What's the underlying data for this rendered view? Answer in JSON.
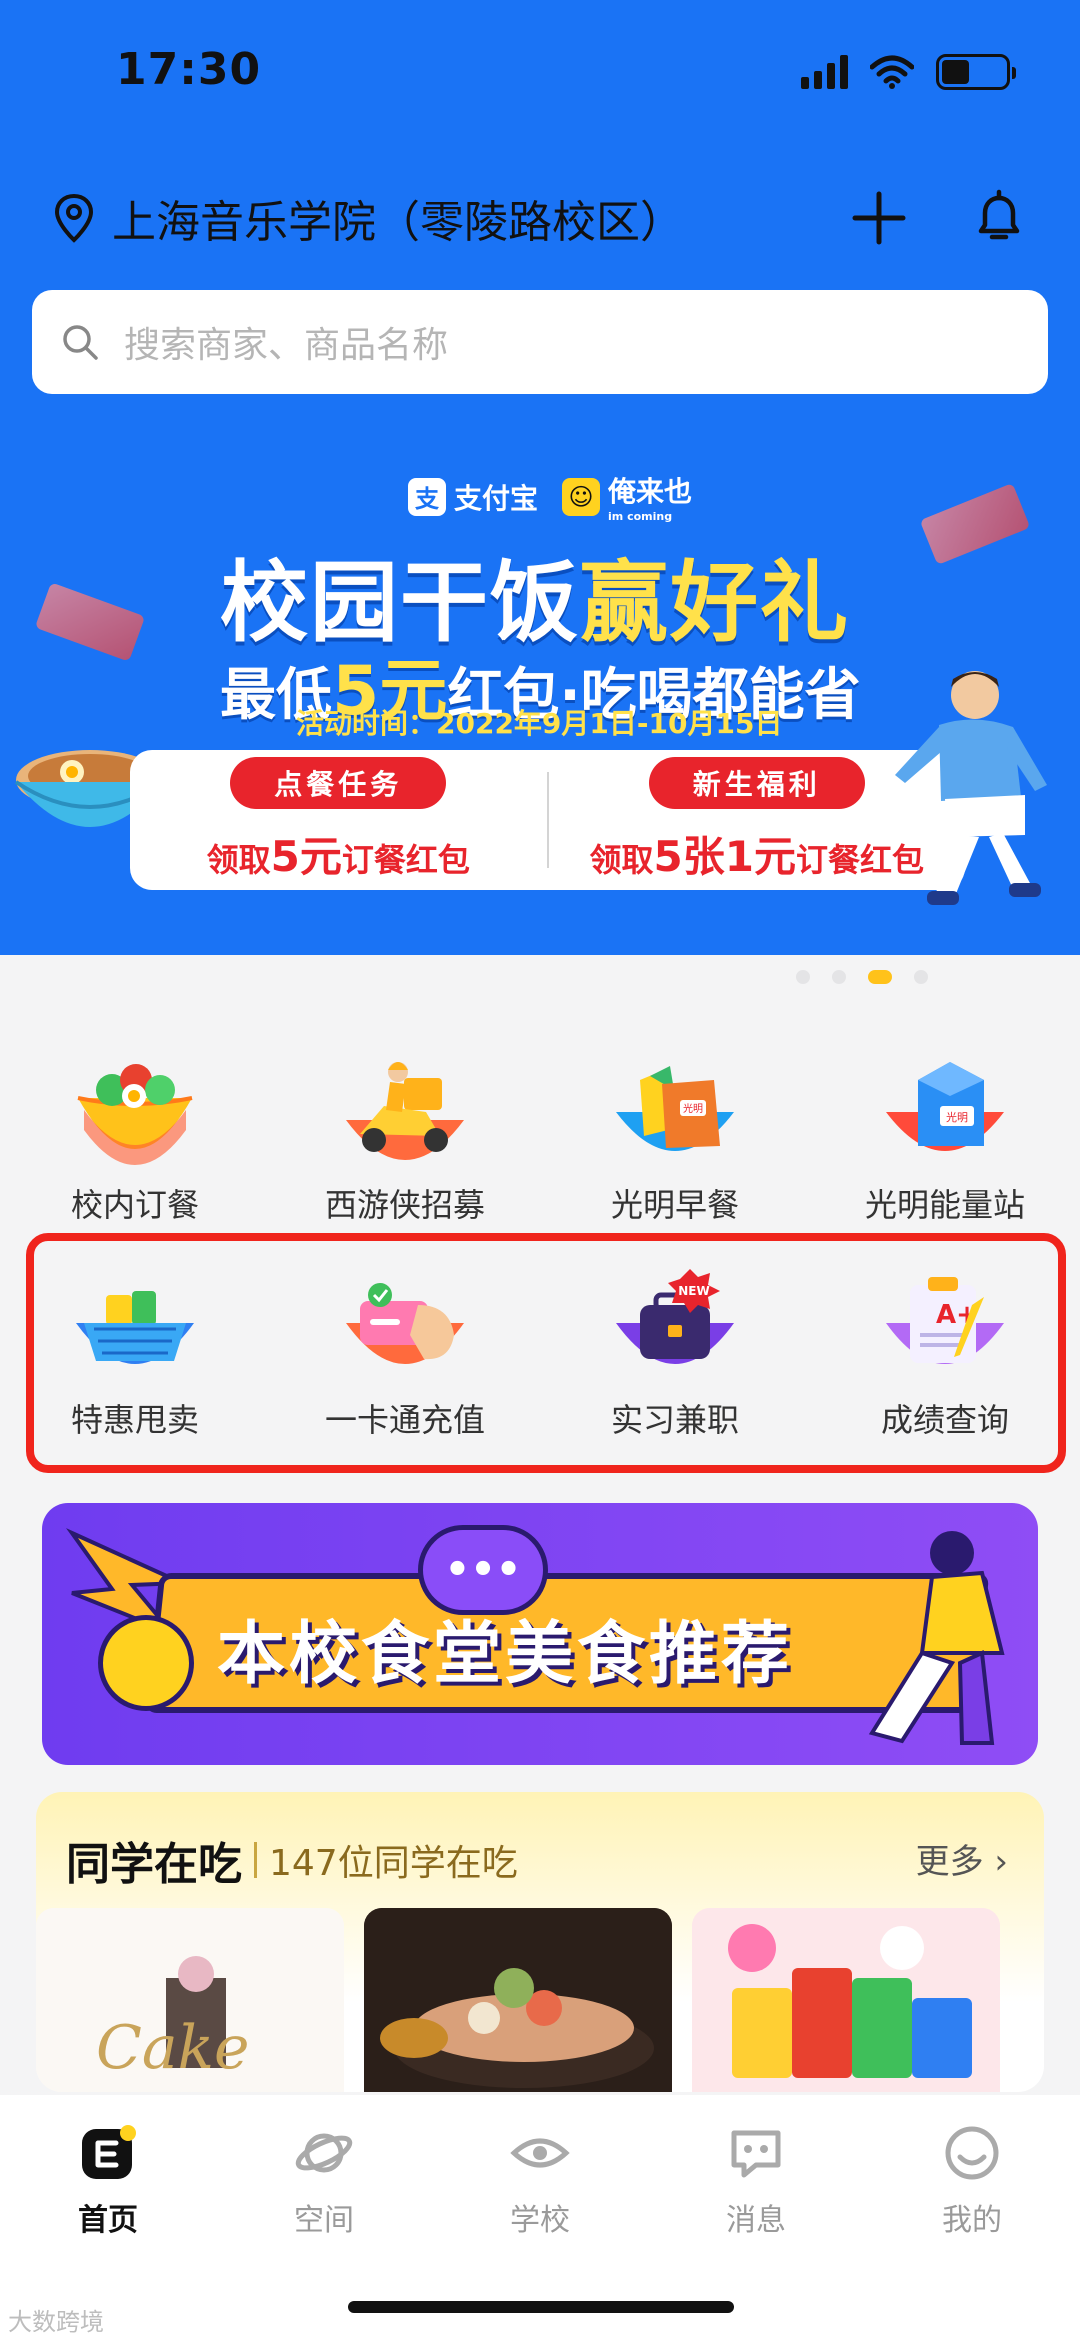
{
  "status_bar": {
    "time": "17:30"
  },
  "header": {
    "location": "上海音乐学院（零陵路校区）",
    "search_placeholder": "搜索商家、商品名称"
  },
  "banner": {
    "brand1": "支付宝",
    "brand2": "俺来也",
    "brand2_sub": "im coming",
    "title_a": "校园干饭",
    "title_b": "赢好礼",
    "sub_a": "最低",
    "sub_b": "5元",
    "sub_c": "红包·吃喝都能省",
    "date": "活动时间：2022年9月1日-10月15日",
    "left_pill": "点餐任务",
    "left_desc_a": "领取",
    "left_desc_b": "5元",
    "left_desc_c": "订餐红包",
    "right_pill": "新生福利",
    "right_desc_a": "领取",
    "right_desc_b": "5张",
    "right_desc_c": "1元",
    "right_desc_d": "订餐红包",
    "page_index": 3,
    "page_count": 4
  },
  "shortcuts_row1": [
    {
      "label": "校内订餐",
      "icon": "salad-bowl-icon"
    },
    {
      "label": "西游侠招募",
      "icon": "delivery-scooter-icon"
    },
    {
      "label": "光明早餐",
      "icon": "breakfast-bag-icon"
    },
    {
      "label": "光明能量站",
      "icon": "milk-carton-icon"
    }
  ],
  "shortcuts_row2": [
    {
      "label": "特惠甩卖",
      "icon": "shopping-basket-icon"
    },
    {
      "label": "一卡通充值",
      "icon": "card-recharge-icon"
    },
    {
      "label": "实习兼职",
      "icon": "briefcase-icon",
      "badge": "NEW"
    },
    {
      "label": "成绩查询",
      "icon": "report-card-icon",
      "grade": "A+"
    }
  ],
  "canteen_banner": {
    "text": "本校食堂美食推荐",
    "bubble": "•••"
  },
  "classmates": {
    "title": "同学在吃",
    "count": "147位同学在吃",
    "more": "更多 ›",
    "cards": [
      {
        "icon": "cake-photo",
        "caption": "Cake"
      },
      {
        "icon": "hotpot-photo"
      },
      {
        "icon": "snacks-photo"
      }
    ]
  },
  "tabbar": [
    {
      "label": "首页",
      "icon": "home-icon",
      "active": true
    },
    {
      "label": "空间",
      "icon": "planet-icon",
      "active": false
    },
    {
      "label": "学校",
      "icon": "eye-icon",
      "active": false
    },
    {
      "label": "消息",
      "icon": "message-icon",
      "active": false
    },
    {
      "label": "我的",
      "icon": "profile-smile-icon",
      "active": false
    }
  ],
  "watermark": "大数跨境",
  "colors": {
    "primary_blue": "#1a73f5",
    "accent_yellow": "#ffc21a",
    "highlight_red": "#f0241c",
    "banner_red": "#e8242c"
  }
}
